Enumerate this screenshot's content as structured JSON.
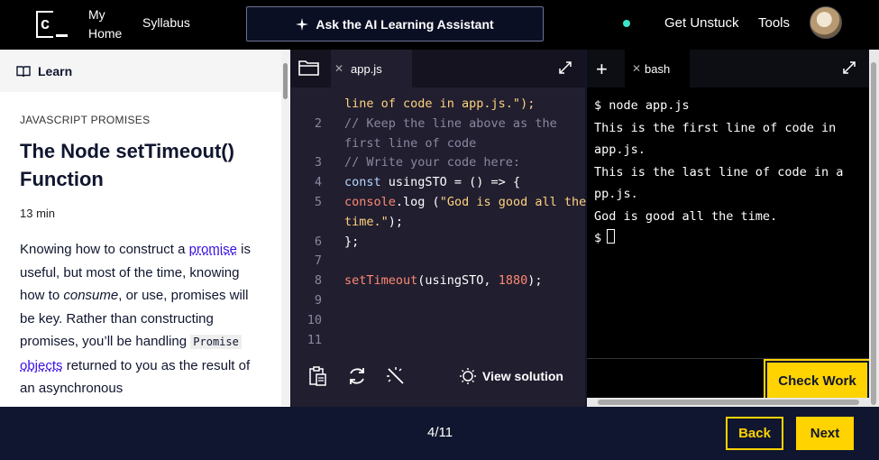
{
  "header": {
    "nav_home": "My Home",
    "nav_home_line1": "My",
    "nav_home_line2": "Home",
    "nav_syllabus": "Syllabus",
    "ai_button": "Ask the AI Learning Assistant",
    "get_unstuck": "Get Unstuck",
    "tools": "Tools",
    "status_dot_color": "#3de3c6"
  },
  "learn": {
    "panel_label": "Learn",
    "kicker": "JAVASCRIPT PROMISES",
    "title": "The Node setTimeout() Function",
    "duration": "13 min",
    "para": {
      "t1": "Knowing how to construct a ",
      "link1": "promise",
      "t2": " is useful, but most of the time, knowing how to ",
      "em": "consume",
      "t3": ", or use, promises will be key. Rather than constructing promises, you’ll be handling ",
      "code": "Promise",
      "t4": " ",
      "link2": "objects",
      "t5": " returned to you as the result of an asynchronous"
    }
  },
  "editor": {
    "tab": "app.js",
    "lines": [
      {
        "num": "",
        "parts": [
          {
            "t": "line of code in app.js.\");",
            "c": "c-str"
          }
        ]
      },
      {
        "num": "2",
        "parts": [
          {
            "t": "// Keep the line above as the",
            "c": "c-cmt"
          }
        ]
      },
      {
        "num": "",
        "parts": [
          {
            "t": "first line of code",
            "c": "c-cmt"
          }
        ]
      },
      {
        "num": "3",
        "parts": [
          {
            "t": "// Write your code here:",
            "c": "c-cmt"
          }
        ]
      },
      {
        "num": "4",
        "parts": [
          {
            "t": "const",
            "c": "c-kw"
          },
          {
            "t": " usingSTO = () => {",
            "c": "c-w"
          }
        ]
      },
      {
        "num": "5",
        "parts": [
          {
            "t": "console",
            "c": "c-fn"
          },
          {
            "t": ".log (",
            "c": "c-w"
          },
          {
            "t": "\"God is good all the",
            "c": "c-str"
          }
        ]
      },
      {
        "num": "",
        "parts": [
          {
            "t": "time.\"",
            "c": "c-str"
          },
          {
            "t": ");",
            "c": "c-w"
          }
        ]
      },
      {
        "num": "6",
        "parts": [
          {
            "t": "};",
            "c": "c-w"
          }
        ]
      },
      {
        "num": "7",
        "parts": [
          {
            "t": "",
            "c": "c-w"
          }
        ]
      },
      {
        "num": "8",
        "parts": [
          {
            "t": "setTimeout",
            "c": "c-fn"
          },
          {
            "t": "(usingSTO, ",
            "c": "c-w"
          },
          {
            "t": "1880",
            "c": "c-fn"
          },
          {
            "t": ");",
            "c": "c-w"
          }
        ]
      },
      {
        "num": "9",
        "parts": [
          {
            "t": "",
            "c": "c-w"
          }
        ]
      },
      {
        "num": "10",
        "parts": [
          {
            "t": "",
            "c": "c-w"
          }
        ]
      },
      {
        "num": "11",
        "parts": [
          {
            "t": "",
            "c": "c-w"
          }
        ]
      }
    ],
    "view_solution": "View solution"
  },
  "terminal": {
    "tab": "bash",
    "lines": [
      "$ node app.js",
      "This is the first line of code in",
      "app.js.",
      "This is the last line of code in a",
      "pp.js.",
      "God is good all the time."
    ],
    "prompt": "$",
    "check_work": "Check Work"
  },
  "footer": {
    "pager": "4/11",
    "back": "Back",
    "next": "Next"
  }
}
